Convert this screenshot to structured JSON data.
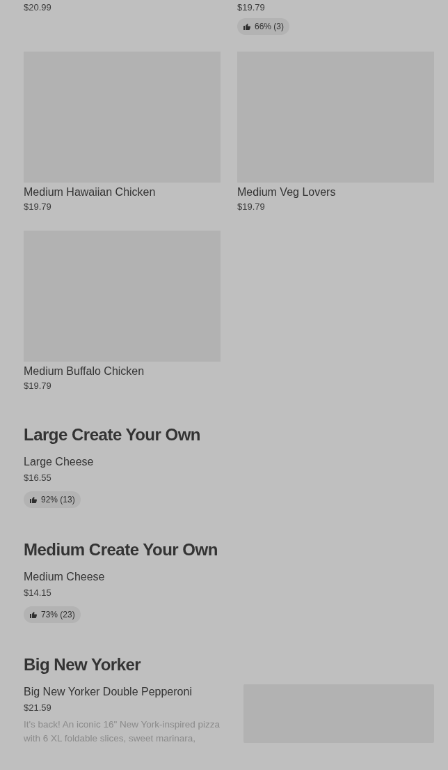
{
  "sections": [
    {
      "kind": "grid",
      "items": [
        {
          "kind": "tail",
          "price": "$20.99"
        },
        {
          "kind": "tail",
          "price": "$19.79",
          "rating": "66% (3)"
        },
        {
          "kind": "card",
          "name": "Medium Hawaiian Chicken",
          "price": "$19.79"
        },
        {
          "kind": "card",
          "name": "Medium Veg Lovers",
          "price": "$19.79"
        },
        {
          "kind": "card",
          "name": "Medium Buffalo Chicken",
          "price": "$19.79"
        }
      ]
    },
    {
      "heading": "Large Create Your Own",
      "kind": "list",
      "items": [
        {
          "kind": "text",
          "name": "Large Cheese",
          "price": "$16.55",
          "rating": "92% (13)"
        }
      ]
    },
    {
      "heading": "Medium Create Your Own",
      "kind": "list",
      "items": [
        {
          "kind": "text",
          "name": "Medium Cheese",
          "price": "$14.15",
          "rating": "73% (23)"
        }
      ]
    },
    {
      "heading": "Big New Yorker",
      "kind": "list",
      "items": [
        {
          "kind": "photo",
          "name": "Big New Yorker Double Pepperoni",
          "price": "$21.59",
          "description": "It's back! An iconic 16\" New York-inspired pizza with 6 XL foldable slices, sweet marinara,"
        }
      ]
    }
  ]
}
